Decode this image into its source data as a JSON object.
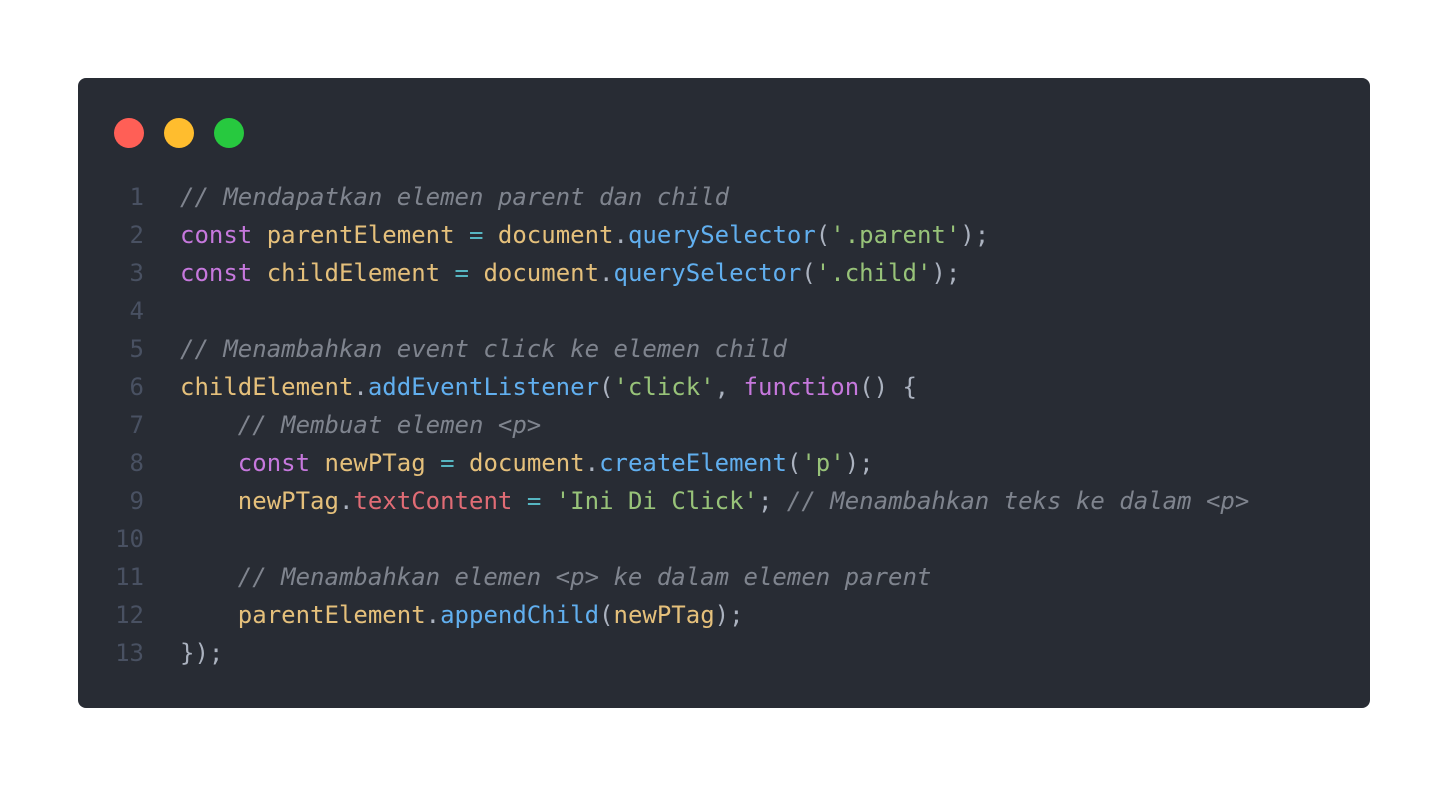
{
  "window": {
    "traffic_lights": [
      {
        "name": "close-dot",
        "color": "#ff5f56"
      },
      {
        "name": "minimize-dot",
        "color": "#ffbd2e"
      },
      {
        "name": "maximize-dot",
        "color": "#27c93f"
      }
    ]
  },
  "code": {
    "lines": [
      {
        "number": "1",
        "indent": "",
        "tokens": [
          {
            "t": "// Mendapatkan elemen parent dan child",
            "k": "comment"
          }
        ]
      },
      {
        "number": "2",
        "indent": "",
        "tokens": [
          {
            "t": "const",
            "k": "keyword"
          },
          {
            "t": " ",
            "k": "plain"
          },
          {
            "t": "parentElement",
            "k": "variable"
          },
          {
            "t": " ",
            "k": "plain"
          },
          {
            "t": "=",
            "k": "operator"
          },
          {
            "t": " ",
            "k": "plain"
          },
          {
            "t": "document",
            "k": "variable"
          },
          {
            "t": ".",
            "k": "punct"
          },
          {
            "t": "querySelector",
            "k": "method"
          },
          {
            "t": "(",
            "k": "punct"
          },
          {
            "t": "'.parent'",
            "k": "string"
          },
          {
            "t": ");",
            "k": "punct"
          }
        ]
      },
      {
        "number": "3",
        "indent": "",
        "tokens": [
          {
            "t": "const",
            "k": "keyword"
          },
          {
            "t": " ",
            "k": "plain"
          },
          {
            "t": "childElement",
            "k": "variable"
          },
          {
            "t": " ",
            "k": "plain"
          },
          {
            "t": "=",
            "k": "operator"
          },
          {
            "t": " ",
            "k": "plain"
          },
          {
            "t": "document",
            "k": "variable"
          },
          {
            "t": ".",
            "k": "punct"
          },
          {
            "t": "querySelector",
            "k": "method"
          },
          {
            "t": "(",
            "k": "punct"
          },
          {
            "t": "'.child'",
            "k": "string"
          },
          {
            "t": ");",
            "k": "punct"
          }
        ]
      },
      {
        "number": "4",
        "indent": "",
        "tokens": []
      },
      {
        "number": "5",
        "indent": "",
        "tokens": [
          {
            "t": "// Menambahkan event click ke elemen child",
            "k": "comment"
          }
        ]
      },
      {
        "number": "6",
        "indent": "",
        "tokens": [
          {
            "t": "childElement",
            "k": "variable"
          },
          {
            "t": ".",
            "k": "punct"
          },
          {
            "t": "addEventListener",
            "k": "method"
          },
          {
            "t": "(",
            "k": "punct"
          },
          {
            "t": "'click'",
            "k": "string"
          },
          {
            "t": ", ",
            "k": "punct"
          },
          {
            "t": "function",
            "k": "keyword"
          },
          {
            "t": "() {",
            "k": "punct"
          }
        ]
      },
      {
        "number": "7",
        "indent": "    ",
        "tokens": [
          {
            "t": "// Membuat elemen <p>",
            "k": "comment"
          }
        ]
      },
      {
        "number": "8",
        "indent": "    ",
        "tokens": [
          {
            "t": "const",
            "k": "keyword"
          },
          {
            "t": " ",
            "k": "plain"
          },
          {
            "t": "newPTag",
            "k": "variable"
          },
          {
            "t": " ",
            "k": "plain"
          },
          {
            "t": "=",
            "k": "operator"
          },
          {
            "t": " ",
            "k": "plain"
          },
          {
            "t": "document",
            "k": "variable"
          },
          {
            "t": ".",
            "k": "punct"
          },
          {
            "t": "createElement",
            "k": "method"
          },
          {
            "t": "(",
            "k": "punct"
          },
          {
            "t": "'p'",
            "k": "string"
          },
          {
            "t": ");",
            "k": "punct"
          }
        ]
      },
      {
        "number": "9",
        "indent": "    ",
        "tokens": [
          {
            "t": "newPTag",
            "k": "variable"
          },
          {
            "t": ".",
            "k": "punct"
          },
          {
            "t": "textContent",
            "k": "property"
          },
          {
            "t": " ",
            "k": "plain"
          },
          {
            "t": "=",
            "k": "operator"
          },
          {
            "t": " ",
            "k": "plain"
          },
          {
            "t": "'Ini Di Click'",
            "k": "string"
          },
          {
            "t": "; ",
            "k": "punct"
          },
          {
            "t": "// Menambahkan teks ke dalam <p>",
            "k": "comment"
          }
        ]
      },
      {
        "number": "10",
        "indent": "",
        "tokens": []
      },
      {
        "number": "11",
        "indent": "    ",
        "tokens": [
          {
            "t": "// Menambahkan elemen <p> ke dalam elemen parent",
            "k": "comment"
          }
        ]
      },
      {
        "number": "12",
        "indent": "    ",
        "tokens": [
          {
            "t": "parentElement",
            "k": "variable"
          },
          {
            "t": ".",
            "k": "punct"
          },
          {
            "t": "appendChild",
            "k": "method"
          },
          {
            "t": "(",
            "k": "punct"
          },
          {
            "t": "newPTag",
            "k": "variable"
          },
          {
            "t": ");",
            "k": "punct"
          }
        ]
      },
      {
        "number": "13",
        "indent": "",
        "tokens": [
          {
            "t": "});",
            "k": "punct"
          }
        ]
      }
    ]
  },
  "theme": {
    "background": "#282c34",
    "comment": "#7f848e",
    "keyword": "#c678dd",
    "variable": "#e5c07b",
    "method": "#61afef",
    "string": "#98c379",
    "property": "#e06c75",
    "operator": "#56b6c2",
    "line_number": "#495162"
  }
}
